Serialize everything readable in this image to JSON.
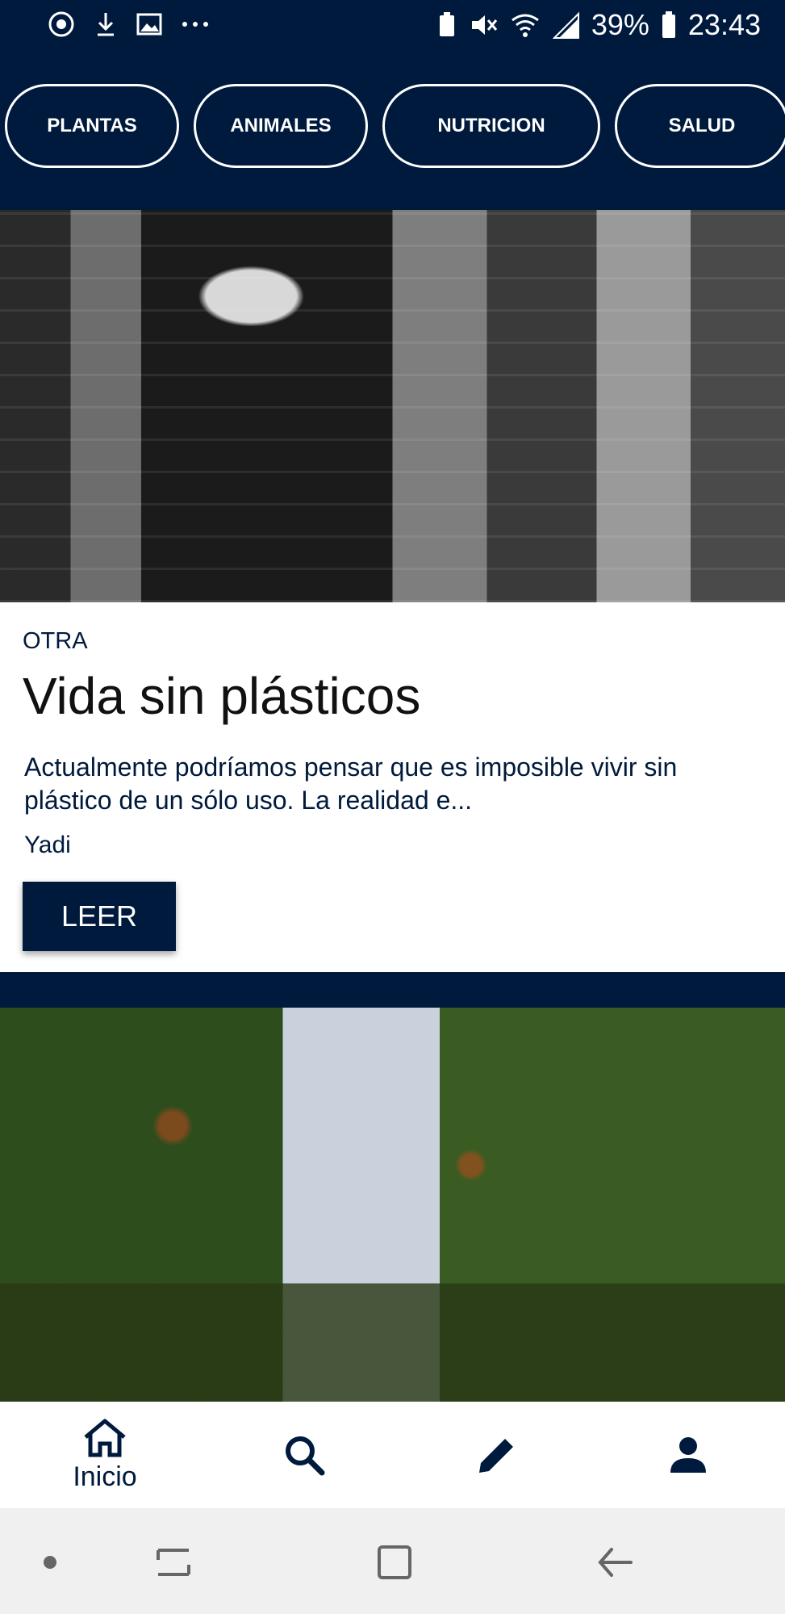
{
  "status_bar": {
    "battery": "39%",
    "time": "23:43"
  },
  "categories": [
    "PLANTAS",
    "ANIMALES",
    "NUTRICION",
    "SALUD"
  ],
  "article": {
    "category": "OTRA",
    "title": "Vida sin plásticos",
    "excerpt": "Actualmente podríamos pensar que es imposible vivir sin plástico de un sólo uso. La realidad e...",
    "author": "Yadi",
    "read_label": "LEER"
  },
  "bottom_nav": {
    "home_label": "Inicio"
  },
  "colors": {
    "primary": "#001a3d",
    "surface": "#ffffff",
    "system_nav": "#f0f0f0"
  }
}
